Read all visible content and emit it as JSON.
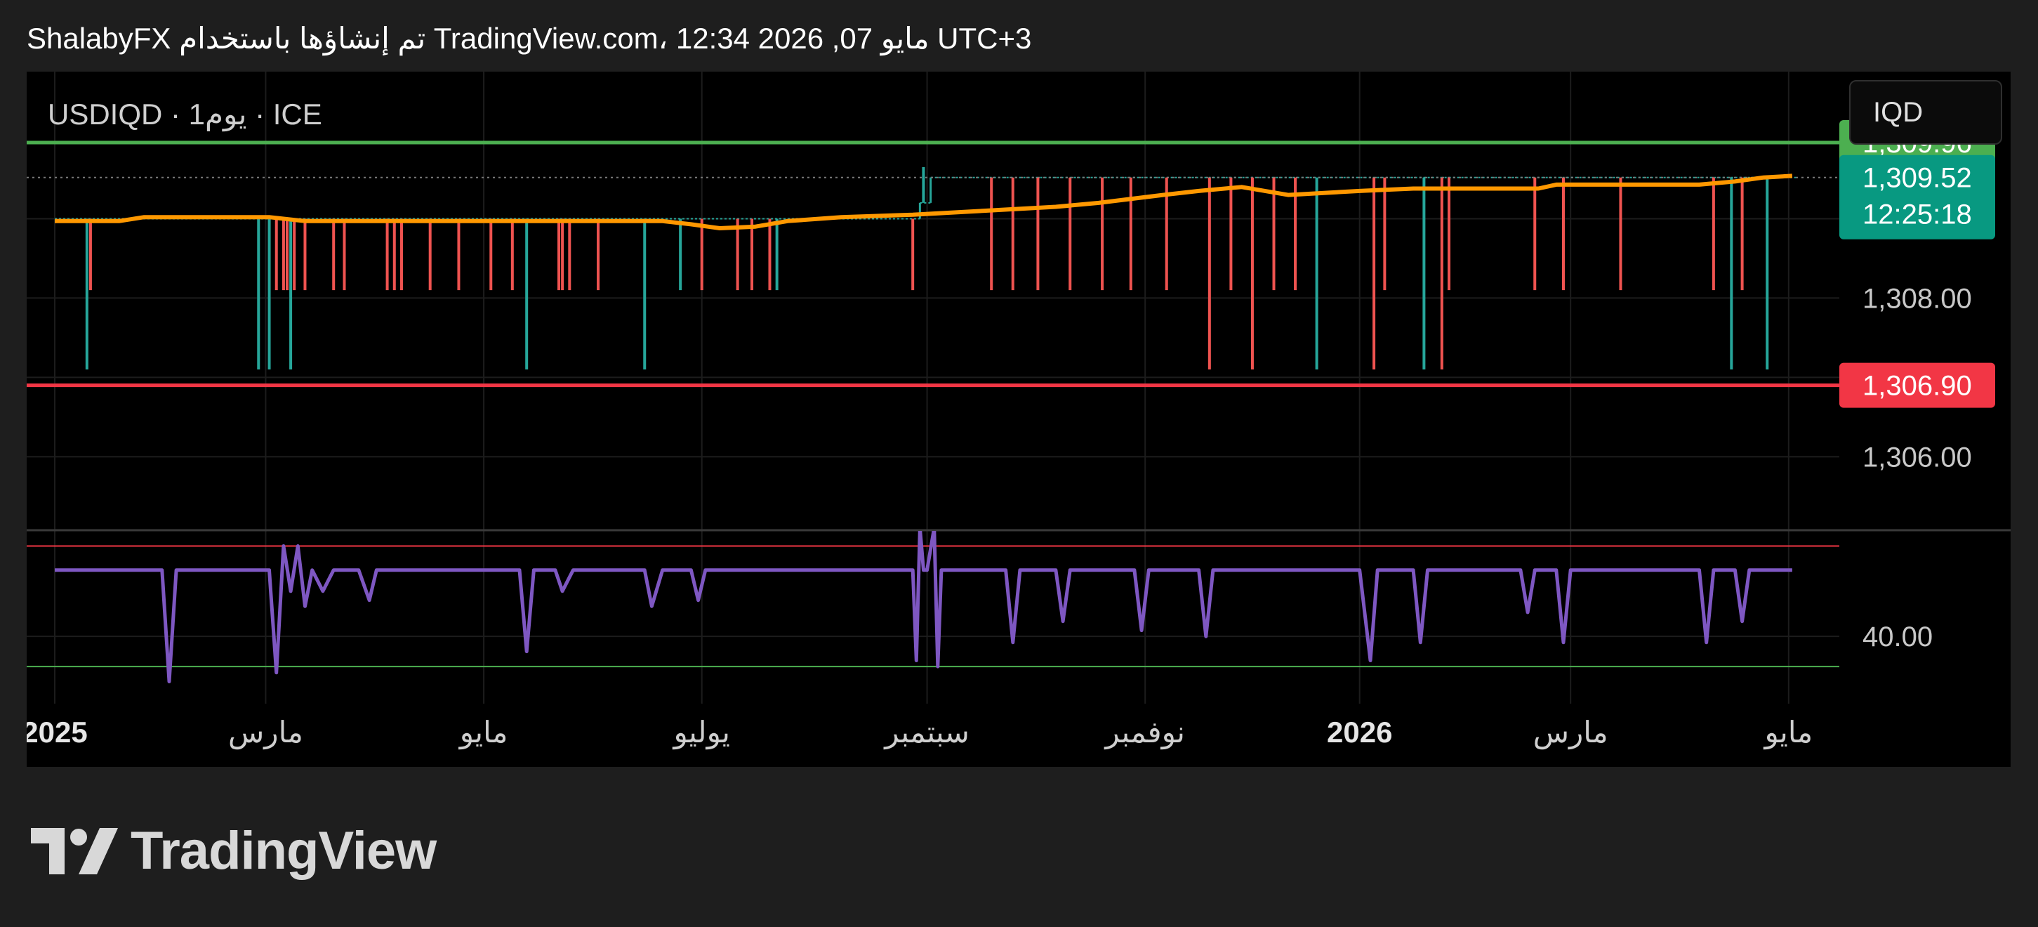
{
  "header": {
    "caption": "ShalabyFX تم إنشاؤها باستخدام TradingView.com، 12:34 2026 ,07 مايو UTC+3"
  },
  "chart_header": {
    "symbol_line": "USDIQD · 1يوم · ICE",
    "currency_button": "IQD"
  },
  "footer": {
    "brand": "TradingView"
  },
  "colors": {
    "up": "#26a69a",
    "down": "#ef5350",
    "ma": "#ff9800",
    "rsi": "#7e57c2",
    "resistance": "#4caf50",
    "support": "#f23645",
    "price_tag": "#089981"
  },
  "chart_data": [
    {
      "type": "bar",
      "ylim": [
        1305.1,
        1310.5
      ],
      "grid": true,
      "x_ticks": [
        {
          "label": "2025",
          "x": 0,
          "bold": true
        },
        {
          "label": "مارس",
          "x": 59
        },
        {
          "label": "مايو",
          "x": 120
        },
        {
          "label": "يوليو",
          "x": 181
        },
        {
          "label": "سبتمبر",
          "x": 244
        },
        {
          "label": "نوفمبر",
          "x": 305
        },
        {
          "label": "2026",
          "x": 365,
          "bold": true
        },
        {
          "label": "مارس",
          "x": 424
        },
        {
          "label": "مايو",
          "x": 485
        }
      ],
      "y_ticks": [
        {
          "label": "1,308.00",
          "value": 1308.0
        },
        {
          "label": "1,306.00",
          "value": 1306.0
        }
      ],
      "horizontal_lines": [
        {
          "value": 1309.96,
          "label": "1,309.96",
          "color": "#4caf50"
        },
        {
          "value": 1306.9,
          "label": "1,306.90",
          "color": "#f23645"
        }
      ],
      "last_price": {
        "value": 1309.52,
        "label": "1,309.52",
        "countdown": "12:25:18"
      },
      "base_levels": [
        {
          "from": 0,
          "to": 242,
          "value": 1309.0
        },
        {
          "from": 242,
          "to": 245,
          "value": 1309.2
        },
        {
          "from": 245,
          "to": 487,
          "value": 1309.52
        }
      ],
      "spikes_down": [
        {
          "x": 10,
          "low": 1308.1
        },
        {
          "x": 60,
          "low": 1308.1
        },
        {
          "x": 62,
          "low": 1308.1
        },
        {
          "x": 64,
          "low": 1308.1
        },
        {
          "x": 65,
          "low": 1308.1
        },
        {
          "x": 67,
          "low": 1308.1
        },
        {
          "x": 70,
          "low": 1308.1
        },
        {
          "x": 78,
          "low": 1308.1
        },
        {
          "x": 81,
          "low": 1308.1
        },
        {
          "x": 93,
          "low": 1308.1
        },
        {
          "x": 95,
          "low": 1308.1
        },
        {
          "x": 97,
          "low": 1308.1
        },
        {
          "x": 105,
          "low": 1308.1
        },
        {
          "x": 113,
          "low": 1308.1
        },
        {
          "x": 122,
          "low": 1308.1
        },
        {
          "x": 128,
          "low": 1308.1
        },
        {
          "x": 141,
          "low": 1308.1
        },
        {
          "x": 142,
          "low": 1308.1
        },
        {
          "x": 144,
          "low": 1308.1
        },
        {
          "x": 152,
          "low": 1308.1
        },
        {
          "x": 181,
          "low": 1308.1
        },
        {
          "x": 191,
          "low": 1308.1
        },
        {
          "x": 195,
          "low": 1308.1
        },
        {
          "x": 200,
          "low": 1308.1
        },
        {
          "x": 240,
          "low": 1308.1
        },
        {
          "x": 262,
          "low": 1308.1
        },
        {
          "x": 268,
          "low": 1308.1
        },
        {
          "x": 275,
          "low": 1308.1
        },
        {
          "x": 284,
          "low": 1308.1
        },
        {
          "x": 293,
          "low": 1308.1
        },
        {
          "x": 301,
          "low": 1308.1
        },
        {
          "x": 311,
          "low": 1308.1
        },
        {
          "x": 323,
          "low": 1307.1
        },
        {
          "x": 329,
          "low": 1308.1
        },
        {
          "x": 335,
          "low": 1307.1
        },
        {
          "x": 341,
          "low": 1308.1
        },
        {
          "x": 347,
          "low": 1308.1
        },
        {
          "x": 369,
          "low": 1307.1
        },
        {
          "x": 372,
          "low": 1308.1
        },
        {
          "x": 388,
          "low": 1307.1
        },
        {
          "x": 390,
          "low": 1308.1
        },
        {
          "x": 414,
          "low": 1308.1
        },
        {
          "x": 422,
          "low": 1308.1
        },
        {
          "x": 438,
          "low": 1308.1
        },
        {
          "x": 464,
          "low": 1308.1
        },
        {
          "x": 472,
          "low": 1308.1
        }
      ],
      "spikes_down_green": [
        {
          "x": 9,
          "low": 1307.1
        },
        {
          "x": 57,
          "low": 1307.1
        },
        {
          "x": 60,
          "low": 1307.1
        },
        {
          "x": 66,
          "low": 1307.1
        },
        {
          "x": 132,
          "low": 1307.1
        },
        {
          "x": 165,
          "low": 1307.1
        },
        {
          "x": 175,
          "low": 1308.1
        },
        {
          "x": 202,
          "low": 1308.1
        },
        {
          "x": 353,
          "low": 1307.1
        },
        {
          "x": 383,
          "low": 1307.1
        },
        {
          "x": 469,
          "low": 1307.1
        },
        {
          "x": 479,
          "low": 1307.1
        }
      ],
      "spikes_up": [
        {
          "x": 243,
          "high": 1309.65
        }
      ],
      "moving_average": [
        [
          0,
          1308.97
        ],
        [
          18,
          1308.97
        ],
        [
          25,
          1309.02
        ],
        [
          60,
          1309.02
        ],
        [
          70,
          1308.97
        ],
        [
          95,
          1308.97
        ],
        [
          110,
          1308.97
        ],
        [
          130,
          1308.97
        ],
        [
          150,
          1308.97
        ],
        [
          170,
          1308.97
        ],
        [
          178,
          1308.93
        ],
        [
          186,
          1308.88
        ],
        [
          196,
          1308.9
        ],
        [
          205,
          1308.97
        ],
        [
          220,
          1309.02
        ],
        [
          240,
          1309.05
        ],
        [
          260,
          1309.1
        ],
        [
          280,
          1309.15
        ],
        [
          292,
          1309.2
        ],
        [
          310,
          1309.3
        ],
        [
          320,
          1309.35
        ],
        [
          332,
          1309.4
        ],
        [
          345,
          1309.3
        ],
        [
          365,
          1309.35
        ],
        [
          380,
          1309.38
        ],
        [
          400,
          1309.38
        ],
        [
          415,
          1309.38
        ],
        [
          420,
          1309.43
        ],
        [
          440,
          1309.43
        ],
        [
          460,
          1309.43
        ],
        [
          470,
          1309.47
        ],
        [
          478,
          1309.52
        ],
        [
          486,
          1309.54
        ]
      ],
      "rsi": {
        "ylim": [
          20,
          75
        ],
        "y_ticks": [
          {
            "label": "40.00",
            "value": 40
          }
        ],
        "overbought": 70,
        "oversold": 30,
        "series": [
          [
            0,
            62
          ],
          [
            30,
            62
          ],
          [
            32,
            25
          ],
          [
            34,
            62
          ],
          [
            60,
            62
          ],
          [
            62,
            28
          ],
          [
            64,
            70
          ],
          [
            66,
            55
          ],
          [
            68,
            70
          ],
          [
            70,
            50
          ],
          [
            72,
            62
          ],
          [
            75,
            55
          ],
          [
            78,
            62
          ],
          [
            85,
            62
          ],
          [
            88,
            52
          ],
          [
            90,
            62
          ],
          [
            95,
            62
          ],
          [
            100,
            62
          ],
          [
            105,
            62
          ],
          [
            115,
            62
          ],
          [
            120,
            62
          ],
          [
            130,
            62
          ],
          [
            132,
            35
          ],
          [
            134,
            62
          ],
          [
            140,
            62
          ],
          [
            142,
            55
          ],
          [
            145,
            62
          ],
          [
            150,
            62
          ],
          [
            165,
            62
          ],
          [
            167,
            50
          ],
          [
            170,
            62
          ],
          [
            178,
            62
          ],
          [
            180,
            52
          ],
          [
            182,
            62
          ],
          [
            190,
            62
          ],
          [
            195,
            62
          ],
          [
            200,
            62
          ],
          [
            240,
            62
          ],
          [
            241,
            32
          ],
          [
            242,
            76
          ],
          [
            243,
            62
          ],
          [
            244,
            62
          ],
          [
            246,
            76
          ],
          [
            247,
            30
          ],
          [
            248,
            62
          ],
          [
            260,
            62
          ],
          [
            266,
            62
          ],
          [
            268,
            38
          ],
          [
            270,
            62
          ],
          [
            280,
            62
          ],
          [
            282,
            45
          ],
          [
            284,
            62
          ],
          [
            295,
            62
          ],
          [
            302,
            62
          ],
          [
            304,
            42
          ],
          [
            306,
            62
          ],
          [
            315,
            62
          ],
          [
            320,
            62
          ],
          [
            322,
            40
          ],
          [
            324,
            62
          ],
          [
            340,
            62
          ],
          [
            345,
            62
          ],
          [
            360,
            62
          ],
          [
            365,
            62
          ],
          [
            368,
            32
          ],
          [
            370,
            62
          ],
          [
            380,
            62
          ],
          [
            382,
            38
          ],
          [
            384,
            62
          ],
          [
            400,
            62
          ],
          [
            410,
            62
          ],
          [
            412,
            48
          ],
          [
            414,
            62
          ],
          [
            420,
            62
          ],
          [
            422,
            38
          ],
          [
            424,
            62
          ],
          [
            445,
            62
          ],
          [
            460,
            62
          ],
          [
            462,
            38
          ],
          [
            464,
            62
          ],
          [
            470,
            62
          ],
          [
            472,
            45
          ],
          [
            474,
            62
          ],
          [
            486,
            62
          ]
        ]
      }
    }
  ]
}
